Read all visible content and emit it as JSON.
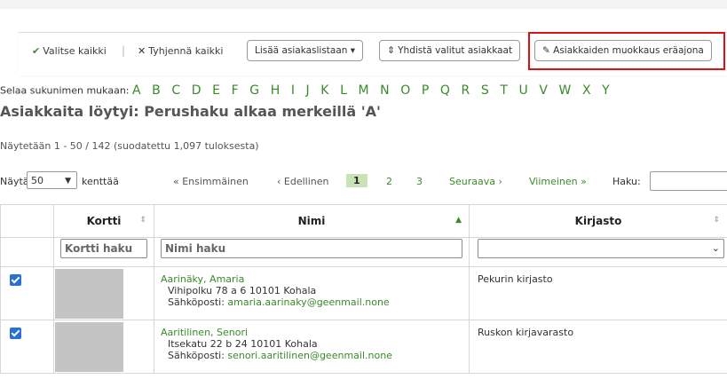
{
  "toolbar": {
    "select_all": "Valitse kaikki",
    "clear_all": "Tyhjennä kaikki",
    "separator": "|",
    "add_to_list": "Lisää asiakaslistaan ▾",
    "merge": "Yhdistä valitut asiakkaat",
    "batch_edit": "Asiakkaiden muokkaus eräajona"
  },
  "browse": {
    "label": "Selaa sukunimen mukaan:",
    "letters": [
      "A",
      "B",
      "C",
      "D",
      "E",
      "F",
      "G",
      "H",
      "I",
      "J",
      "K",
      "L",
      "M",
      "N",
      "O",
      "P",
      "Q",
      "R",
      "S",
      "T",
      "U",
      "V",
      "W",
      "X",
      "Y"
    ]
  },
  "heading": "Asiakkaita löytyi: Perushaku alkaa merkeillä 'A'",
  "showing": "Näytetään 1 - 50 / 142 (suodatettu 1,097 tuloksesta)",
  "table_controls": {
    "show_label": "Näytä",
    "page_length": "50",
    "entries_label": "kenttää",
    "first": "« Ensimmäinen",
    "previous": "‹ Edellinen",
    "pages": [
      "1",
      "2",
      "3"
    ],
    "next": "Seuraava ›",
    "last": "Viimeinen »",
    "search_label": "Haku:"
  },
  "columns": {
    "card": "Kortti",
    "name": "Nimi",
    "library": "Kirjasto"
  },
  "filters": {
    "card_placeholder": "Kortti haku",
    "name_placeholder": "Nimi haku"
  },
  "rows": [
    {
      "name": "Aarinäky, Amaria",
      "address": "Vihipolku 78 a 6  10101 Kohala",
      "email_label": "Sähköposti:",
      "email": "amaria.aarinaky@geenmail.none",
      "library": "Pekurin kirjasto"
    },
    {
      "name": "Aaritilinen, Senori",
      "address": "Itsekatu 22 b 24  10101 Kohala",
      "email_label": "Sähköposti:",
      "email": "senori.aaritilinen@geenmail.none",
      "library": "Ruskon kirjavarasto"
    }
  ],
  "colors": {
    "accent": "#3a8a2b",
    "highlight": "#e01010",
    "checkbox": "#2a6fd6"
  }
}
